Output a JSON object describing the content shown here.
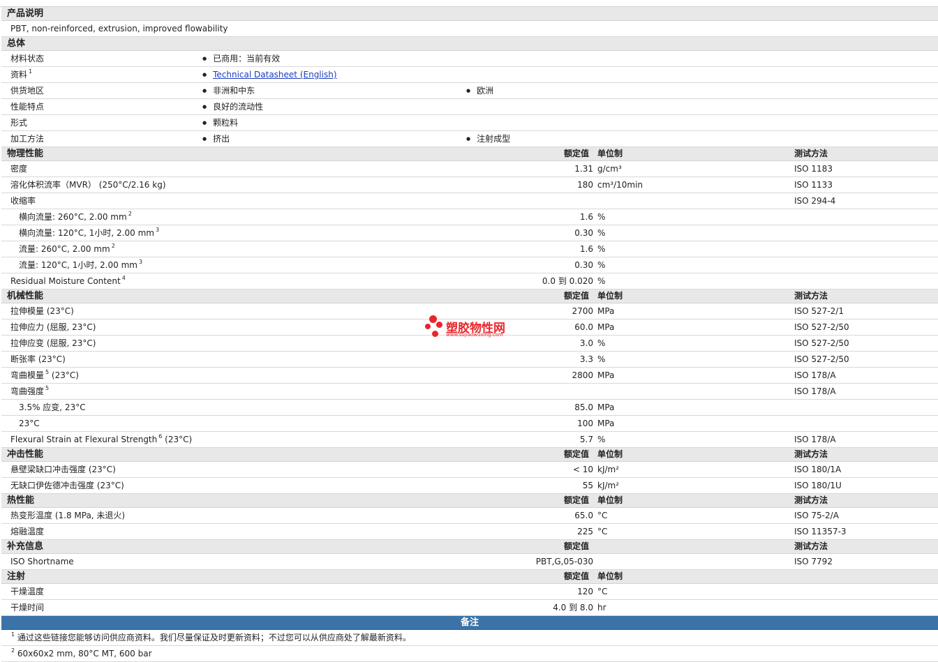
{
  "sections": {
    "product_desc": "产品说明",
    "general": "总体",
    "physical": "物理性能",
    "mechanical": "机械性能",
    "impact": "冲击性能",
    "thermal": "热性能",
    "supplemental": "补充信息",
    "injection": "注射",
    "notes": "备注"
  },
  "headers": {
    "nominal": "额定值",
    "unit": "单位制",
    "test": "测试方法"
  },
  "description": "PBT, non-reinforced, extrusion, improved flowability",
  "general": {
    "status_label": "材料状态",
    "status_value": "已商用：当前有效",
    "docs_label": "资料",
    "docs_sup": "1",
    "docs_link": "Technical Datasheet (English)",
    "region_label": "供货地区",
    "region_1": "非洲和中东",
    "region_2": "欧洲",
    "features_label": "性能特点",
    "features_1": "良好的流动性",
    "form_label": "形式",
    "form_1": "颗粒料",
    "process_label": "加工方法",
    "process_1": "挤出",
    "process_2": "注射成型"
  },
  "physical_rows": [
    {
      "label": "密度",
      "sup": "",
      "value": "1.31",
      "unit": "g/cm³",
      "test": "ISO 1183"
    },
    {
      "label": "溶化体积流率（MVR） (250°C/2.16 kg)",
      "sup": "",
      "value": "180",
      "unit": "cm³/10min",
      "test": "ISO 1133"
    },
    {
      "label": "收缩率",
      "sup": "",
      "value": "",
      "unit": "",
      "test": "ISO 294-4"
    },
    {
      "label": "横向流量: 260°C, 2.00 mm",
      "sup": "2",
      "value": "1.6",
      "unit": "%",
      "test": ""
    },
    {
      "label": "横向流量: 120°C, 1小时, 2.00 mm",
      "sup": "3",
      "value": "0.30",
      "unit": "%",
      "test": ""
    },
    {
      "label": "流量: 260°C, 2.00 mm",
      "sup": "2",
      "value": "1.6",
      "unit": "%",
      "test": ""
    },
    {
      "label": "流量: 120°C, 1小时, 2.00 mm",
      "sup": "3",
      "value": "0.30",
      "unit": "%",
      "test": ""
    },
    {
      "label": "Residual Moisture Content",
      "sup": "4",
      "value": "0.0 到  0.020",
      "unit": "%",
      "test": ""
    }
  ],
  "mechanical_rows": [
    {
      "label": "拉伸模量 (23°C)",
      "sup": "",
      "value": "2700",
      "unit": "MPa",
      "test": "ISO 527-2/1"
    },
    {
      "label": "拉伸应力 (屈服, 23°C)",
      "sup": "",
      "value": "60.0",
      "unit": "MPa",
      "test": "ISO 527-2/50"
    },
    {
      "label": "拉伸应变 (屈服, 23°C)",
      "sup": "",
      "value": "3.0",
      "unit": "%",
      "test": "ISO 527-2/50"
    },
    {
      "label": "断张率 (23°C)",
      "sup": "",
      "value": "3.3",
      "unit": "%",
      "test": "ISO 527-2/50"
    },
    {
      "label": "弯曲模量",
      "sup": "5",
      "suffix": " (23°C)",
      "value": "2800",
      "unit": "MPa",
      "test": "ISO 178/A"
    },
    {
      "label": "弯曲强度",
      "sup": "5",
      "value": "",
      "unit": "",
      "test": "ISO 178/A"
    },
    {
      "label": "3.5% 应变, 23°C",
      "sup": "",
      "value": "85.0",
      "unit": "MPa",
      "test": ""
    },
    {
      "label": "23°C",
      "sup": "",
      "value": "100",
      "unit": "MPa",
      "test": ""
    },
    {
      "label": "Flexural Strain at Flexural Strength",
      "sup": "6",
      "suffix": " (23°C)",
      "value": "5.7",
      "unit": "%",
      "test": "ISO 178/A"
    }
  ],
  "impact_rows": [
    {
      "label": "悬壁梁缺口冲击强度 (23°C)",
      "value": "< 10",
      "unit": "kJ/m²",
      "test": "ISO 180/1A"
    },
    {
      "label": "无缺口伊佐德冲击强度 (23°C)",
      "value": "55",
      "unit": "kJ/m²",
      "test": "ISO 180/1U"
    }
  ],
  "thermal_rows": [
    {
      "label": "热变形温度 (1.8 MPa, 未退火)",
      "value": "65.0",
      "unit": "°C",
      "test": "ISO 75-2/A"
    },
    {
      "label": "熔融温度",
      "value": "225",
      "unit": "°C",
      "test": "ISO 11357-3"
    }
  ],
  "supplemental_rows": [
    {
      "label": "ISO Shortname",
      "value": "PBT,G,05-030",
      "unit": "",
      "test": "ISO 7792"
    }
  ],
  "injection_rows": [
    {
      "label": "干燥温度",
      "value": "120",
      "unit": "°C"
    },
    {
      "label": "干燥时间",
      "value": "4.0 到  8.0",
      "unit": "hr"
    }
  ],
  "notes": [
    {
      "num": "1",
      "text": "通过这些链接您能够访问供应商资料。我们尽量保证及时更新资料；不过您可以从供应商处了解最新资料。"
    },
    {
      "num": "2",
      "text": "60x60x2 mm, 80°C MT, 600 bar"
    }
  ],
  "watermark": {
    "name": "塑胶物性网",
    "url": "www.sujiaowuxing.com",
    "color": "#e8262b"
  }
}
